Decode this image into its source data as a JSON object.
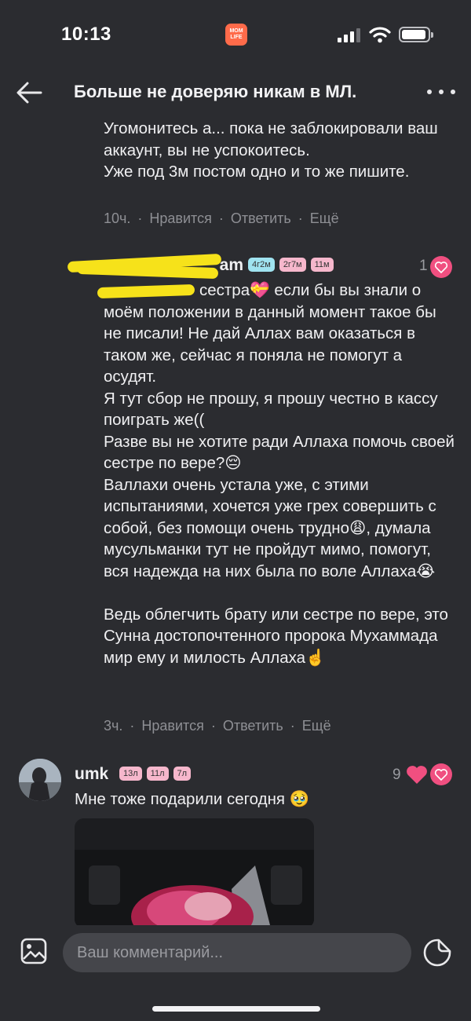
{
  "status_bar": {
    "time": "10:13",
    "app_badge_text": "MOM LIFE"
  },
  "header": {
    "title": "Больше не доверяю никам в МЛ."
  },
  "comments": [
    {
      "text": "Угомонитесь а... пока не заблокировали ваш аккаунт, вы не успокоитесь.\nУже под 3м постом одно и то же пишите.",
      "time": "10ч.",
      "like_label": "Нравится",
      "reply_label": "Ответить",
      "more_label": "Ещё"
    },
    {
      "username_visible": "am",
      "username_redacted": true,
      "badges": [
        "4г2м",
        "2г7м",
        "11м"
      ],
      "like_count": "1",
      "mention_redacted": true,
      "text": "сестра💝  если бы вы знали о моём положении в данный момент такое бы не писали! Не дай Аллах вам оказаться в таком же, сейчас я поняла не помогут а осудят.\nЯ тут сбор не прошу, я прошу честно в кассу поиграть же((\nРазве вы не хотите ради Аллаха помочь своей сестре по вере?😔\nВаллахи очень устала уже, с этими испытаниями, хочется уже грех совершить с собой, без помощи очень трудно😩, думала мусульманки тут не пройдут мимо, помогут, вся надежда на них была по воле Аллаха😭\n\nВедь облегчить брату или сестре по вере, это Сунна достопочтенного пророка Мухаммада мир ему и милость Аллаха☝️",
      "time": "3ч.",
      "like_label": "Нравится",
      "reply_label": "Ответить",
      "more_label": "Ещё"
    },
    {
      "username": "umk",
      "badges": [
        "13л",
        "11л",
        "7л"
      ],
      "like_count": "9",
      "text": "Мне тоже подарили сегодня 🥹"
    }
  ],
  "composer": {
    "placeholder": "Ваш комментарий..."
  },
  "colors": {
    "background": "#2b2c30",
    "accent_pink": "#f04f80",
    "badge_blue": "#9fe3f0",
    "badge_pink": "#f6b7cc",
    "redaction_yellow": "#f6e21a"
  },
  "icons": [
    "back-arrow-icon",
    "more-icon",
    "heart-icon",
    "image-icon",
    "sticker-icon"
  ]
}
